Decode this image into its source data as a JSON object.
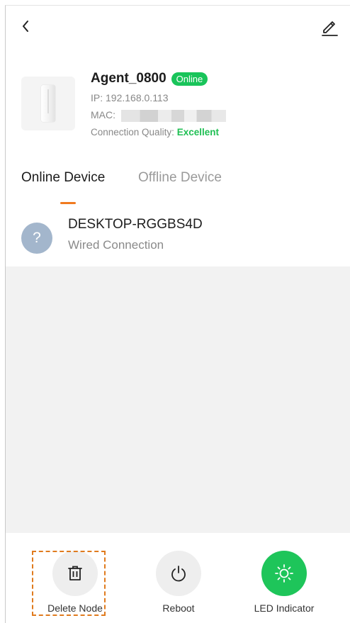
{
  "header": {
    "back_icon": "chevron-left-icon",
    "edit_icon": "pencil-icon"
  },
  "device": {
    "name": "Agent_0800",
    "status_badge": "Online",
    "ip_label": "IP:",
    "ip_value": "192.168.0.113",
    "mac_label": "MAC:",
    "mac_value_redacted": true,
    "quality_label": "Connection Quality:",
    "quality_value": "Excellent",
    "status_color": "#19c45a"
  },
  "tabs": {
    "online_label": "Online Device",
    "offline_label": "Offline Device",
    "active": "online",
    "accent_color": "#f07a1f"
  },
  "clients": [
    {
      "icon": "question-mark-icon",
      "avatar_glyph": "?",
      "name": "DESKTOP-RGGBS4D",
      "connection": "Wired Connection"
    }
  ],
  "actions": {
    "delete_label": "Delete Node",
    "reboot_label": "Reboot",
    "led_label": "LED Indicator",
    "led_color": "#1ec55a"
  }
}
